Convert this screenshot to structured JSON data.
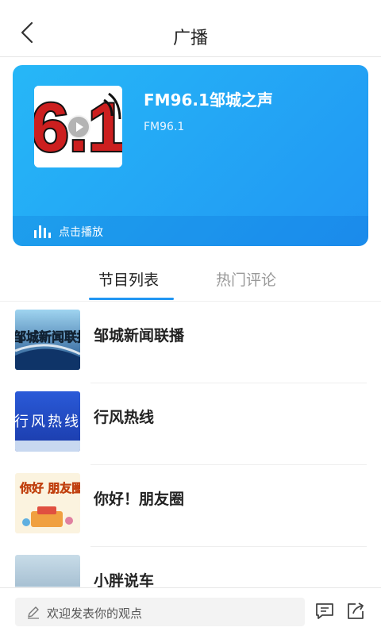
{
  "header": {
    "title": "广播"
  },
  "station": {
    "name": "FM96.1邹城之声",
    "frequency": "FM96.1",
    "cover_text": "96.1",
    "play_label": "点击播放",
    "accent_color": "#2196f3"
  },
  "tabs": [
    {
      "label": "节目列表",
      "active": true
    },
    {
      "label": "热门评论",
      "active": false
    }
  ],
  "programs": [
    {
      "name": "邹城新闻联播",
      "thumb_text": "邹城新闻联播"
    },
    {
      "name": "行风热线",
      "thumb_text": "行风热线"
    },
    {
      "name": "你好！朋友圈",
      "thumb_text": "你好 朋友圈"
    },
    {
      "name": "小胖说车",
      "thumb_text": ""
    }
  ],
  "footer": {
    "comment_placeholder": "欢迎发表你的观点",
    "icons": [
      "comment-icon",
      "share-icon"
    ]
  }
}
